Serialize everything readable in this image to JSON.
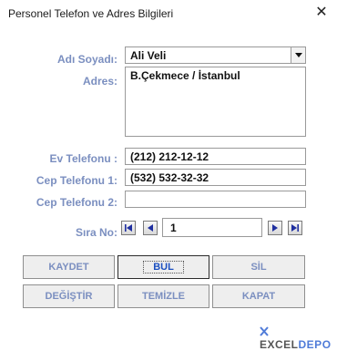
{
  "window": {
    "title": "Personel Telefon ve Adres Bilgileri",
    "close_glyph": "✕"
  },
  "form": {
    "adi_soyadi": {
      "label": "Adı Soyadı:",
      "value": "Ali Veli"
    },
    "adres": {
      "label": "Adres:",
      "value": "B.Çekmece / İstanbul"
    },
    "ev_telefonu": {
      "label": "Ev Telefonu :",
      "value": "(212) 212-12-12"
    },
    "cep_telefonu_1": {
      "label": "Cep Telefonu 1:",
      "value": "(532) 532-32-32"
    },
    "cep_telefonu_2": {
      "label": "Cep Telefonu 2:",
      "value": ""
    },
    "sira_no": {
      "label": "Sıra No:",
      "value": "1"
    }
  },
  "buttons": {
    "kaydet": "KAYDET",
    "bul": "BUL",
    "sil": "SİL",
    "degistir": "DEĞİŞTİR",
    "temizle": "TEMİZLE",
    "kapat": "KAPAT"
  },
  "nav_icons": [
    "first-record-icon",
    "previous-record-icon",
    "next-record-icon",
    "last-record-icon"
  ],
  "logo": {
    "part1": "EXCEL",
    "part2": "DEPO"
  },
  "colors": {
    "label": "#7b8fc0",
    "logo_accent": "#4f7bd8"
  }
}
